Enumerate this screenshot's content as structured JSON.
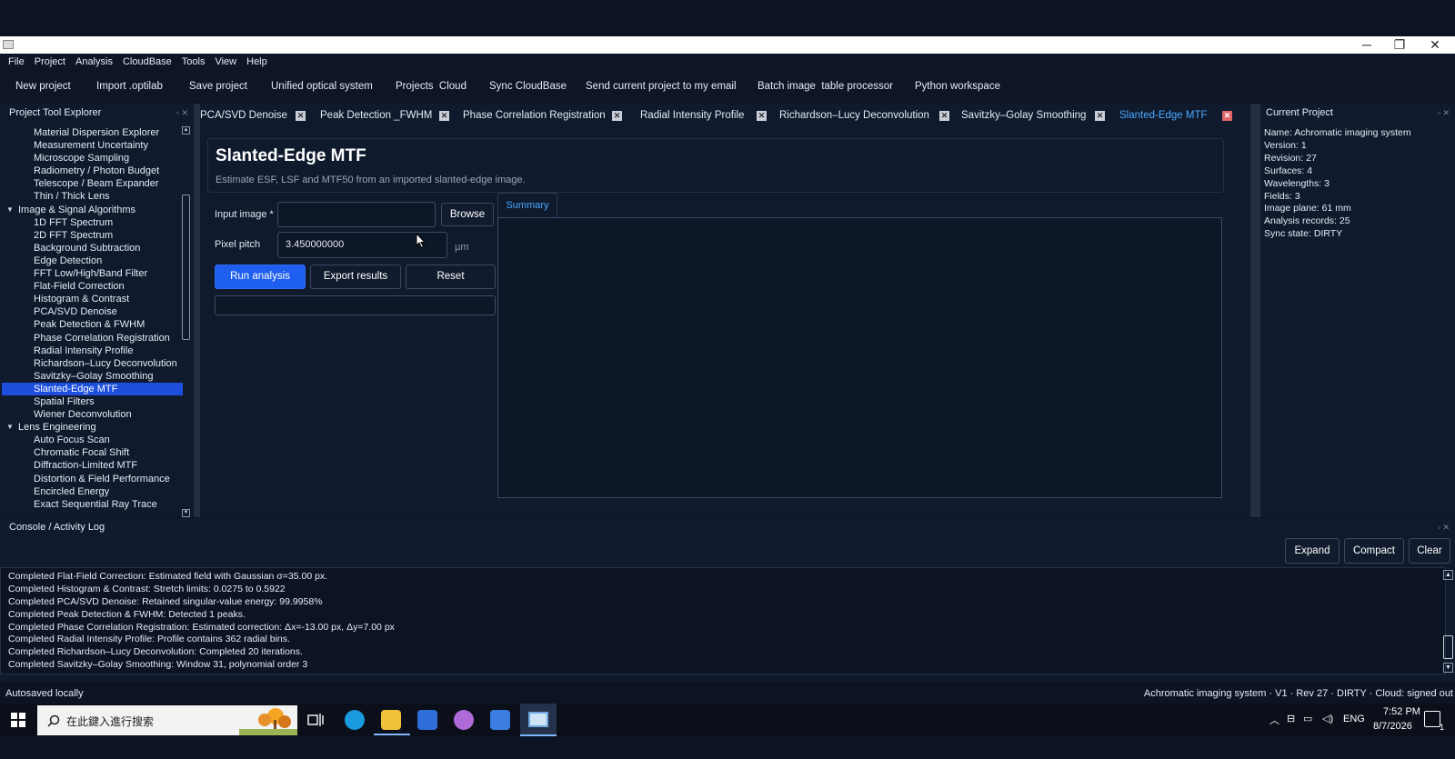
{
  "window": {
    "controls": {
      "minimize": "─",
      "maximize": "❐",
      "close": "✕"
    }
  },
  "menu": [
    "File",
    "Project",
    "Analysis",
    "CloudBase",
    "Tools",
    "View",
    "Help"
  ],
  "toolbar": [
    "New project",
    "Import .optilab",
    "Save project",
    "Unified optical system",
    "Projects  Cloud",
    "Sync CloudBase",
    "Send current project to my email",
    "Batch image  table processor",
    "Python workspace"
  ],
  "left_panel": {
    "title": "Project  Tool Explorer",
    "tree": [
      {
        "label": "Material Dispersion Explorer",
        "level": 1
      },
      {
        "label": "Measurement Uncertainty",
        "level": 1
      },
      {
        "label": "Microscope Sampling",
        "level": 1
      },
      {
        "label": "Radiometry / Photon Budget",
        "level": 1
      },
      {
        "label": "Telescope / Beam Expander",
        "level": 1
      },
      {
        "label": "Thin / Thick Lens",
        "level": 1
      },
      {
        "label": "Image & Signal Algorithms",
        "level": 0
      },
      {
        "label": "1D FFT Spectrum",
        "level": 1
      },
      {
        "label": "2D FFT Spectrum",
        "level": 1
      },
      {
        "label": "Background Subtraction",
        "level": 1
      },
      {
        "label": "Edge Detection",
        "level": 1
      },
      {
        "label": "FFT Low/High/Band Filter",
        "level": 1
      },
      {
        "label": "Flat-Field Correction",
        "level": 1
      },
      {
        "label": "Histogram & Contrast",
        "level": 1
      },
      {
        "label": "PCA/SVD Denoise",
        "level": 1
      },
      {
        "label": "Peak Detection & FWHM",
        "level": 1
      },
      {
        "label": "Phase Correlation Registration",
        "level": 1
      },
      {
        "label": "Radial Intensity Profile",
        "level": 1
      },
      {
        "label": "Richardson–Lucy Deconvolution",
        "level": 1
      },
      {
        "label": "Savitzky–Golay Smoothing",
        "level": 1
      },
      {
        "label": "Slanted-Edge MTF",
        "level": 1,
        "selected": true
      },
      {
        "label": "Spatial Filters",
        "level": 1
      },
      {
        "label": "Wiener Deconvolution",
        "level": 1
      },
      {
        "label": "Lens Engineering",
        "level": 0
      },
      {
        "label": "Auto Focus Scan",
        "level": 1
      },
      {
        "label": "Chromatic Focal Shift",
        "level": 1
      },
      {
        "label": "Diffraction-Limited MTF",
        "level": 1
      },
      {
        "label": "Distortion & Field Performance",
        "level": 1
      },
      {
        "label": "Encircled Energy",
        "level": 1
      },
      {
        "label": "Exact Sequential Ray Trace",
        "level": 1
      }
    ]
  },
  "tabs": [
    {
      "label": "PCA/SVD Denoise"
    },
    {
      "label": "Peak Detection _FWHM"
    },
    {
      "label": "Phase Correlation Registration"
    },
    {
      "label": "Radial Intensity Profile"
    },
    {
      "label": "Richardson–Lucy Deconvolution"
    },
    {
      "label": "Savitzky–Golay Smoothing"
    },
    {
      "label": "Slanted-Edge MTF",
      "active": true
    }
  ],
  "tool": {
    "title": "Slanted-Edge MTF",
    "subtitle": "Estimate ESF, LSF and MTF50 from an imported slanted-edge image.",
    "input_image_label": "Input image *",
    "input_image_value": "",
    "browse_label": "Browse",
    "pixel_pitch_label": "Pixel pitch",
    "pixel_pitch_value": "3.450000000",
    "pixel_pitch_unit": "µm",
    "run_label": "Run analysis",
    "export_label": "Export results",
    "reset_label": "Reset",
    "results_tab": "Summary"
  },
  "right_panel": {
    "title": "Current Project",
    "props": [
      "Name: Achromatic imaging system",
      "Version: 1",
      "Revision: 27",
      "Surfaces: 4",
      "Wavelengths: 3",
      "Fields: 3",
      "Image plane: 61 mm",
      "Analysis records: 25",
      "Sync state: DIRTY"
    ]
  },
  "console": {
    "title": "Console / Activity Log",
    "expand_label": "Expand",
    "compact_label": "Compact",
    "clear_label": "Clear",
    "lines": [
      "Completed Flat-Field Correction: Estimated field with Gaussian σ=35.00 px.",
      "Completed Histogram & Contrast: Stretch limits: 0.0275 to 0.5922",
      "Completed PCA/SVD Denoise: Retained singular-value energy: 99.9958%",
      "Completed Peak Detection & FWHM: Detected 1 peaks.",
      "Completed Phase Correlation Registration: Estimated correction: Δx=-13.00 px, Δy=7.00 px",
      "Completed Radial Intensity Profile: Profile contains 362 radial bins.",
      "Completed Richardson–Lucy Deconvolution: Completed 20 iterations.",
      "Completed Savitzky–Golay Smoothing: Window 31, polynomial order 3"
    ]
  },
  "status": {
    "left": "Autosaved locally",
    "right": "Achromatic imaging system · V1 · Rev 27 · DIRTY · Cloud: signed out"
  },
  "taskbar": {
    "search_placeholder": "在此鍵入進行搜索",
    "lang": "ENG",
    "time": "7:52 PM",
    "date": "8/7/2026",
    "notif_count": "1"
  }
}
